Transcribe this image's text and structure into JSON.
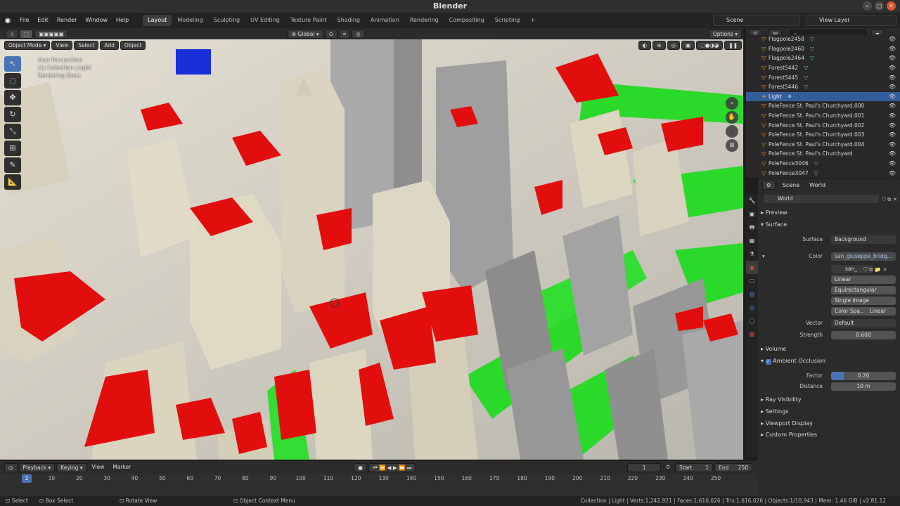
{
  "app": {
    "title": "Blender"
  },
  "menu": [
    "File",
    "Edit",
    "Render",
    "Window",
    "Help"
  ],
  "workspaces": [
    "Layout",
    "Modeling",
    "Sculpting",
    "UV Editing",
    "Texture Paint",
    "Shading",
    "Animation",
    "Rendering",
    "Compositing",
    "Scripting"
  ],
  "active_workspace": "Layout",
  "scene": {
    "scene_name": "Scene",
    "view_layer": "View Layer"
  },
  "viewport": {
    "mode": "Object Mode",
    "menus": [
      "View",
      "Select",
      "Add",
      "Object"
    ],
    "orientation": "Global",
    "options_label": "Options",
    "overlay_lines": [
      "User Perspective",
      "(1) Collection | Light",
      "Rendering Done"
    ]
  },
  "outliner": {
    "items": [
      {
        "name": "Flagpole2458",
        "mesh": true
      },
      {
        "name": "Flagpole2460",
        "mesh": true
      },
      {
        "name": "Flagpole2464",
        "mesh": true
      },
      {
        "name": "Forest5442",
        "mesh": true
      },
      {
        "name": "Forest5445",
        "mesh": true
      },
      {
        "name": "Forest5446",
        "mesh": true
      },
      {
        "name": "Light",
        "mesh": false,
        "selected": true
      },
      {
        "name": "PoleFence St. Paul's Churchyard.000",
        "mesh": false
      },
      {
        "name": "PoleFence St. Paul's Churchyard.001",
        "mesh": false
      },
      {
        "name": "PoleFence St. Paul's Churchyard.002",
        "mesh": false
      },
      {
        "name": "PoleFence St. Paul's Churchyard.003",
        "mesh": false
      },
      {
        "name": "PoleFence St. Paul's Churchyard.004",
        "mesh": false
      },
      {
        "name": "PoleFence St. Paul's Churchyard",
        "mesh": false
      },
      {
        "name": "PoleFence3046",
        "mesh": true
      },
      {
        "name": "PoleFence3047",
        "mesh": true
      }
    ]
  },
  "properties": {
    "breadcrumb": [
      "Scene",
      "World"
    ],
    "world_name": "World",
    "sections": {
      "preview": "Preview",
      "surface": "Surface",
      "volume": "Volume",
      "ao": "Ambient Occlusion",
      "ray_visibility": "Ray Visibility",
      "settings": "Settings",
      "viewport_display": "Viewport Display",
      "custom_properties": "Custom Properties"
    },
    "surface_label": "Surface",
    "surface_value": "Background",
    "color_label": "Color",
    "color_value": "san_giuseppe_bridg...",
    "image_name": "san_",
    "interp": "Linear",
    "projection": "Equirectangular",
    "source": "Single Image",
    "colorspace_label": "Color Spa..",
    "colorspace_value": "Linear",
    "vector_label": "Vector",
    "vector_value": "Default",
    "strength_label": "Strength",
    "strength_value": "0.600",
    "factor_label": "Factor",
    "factor_value": "0.20",
    "factor_fraction": 0.2,
    "distance_label": "Distance",
    "distance_value": "10 m"
  },
  "timeline": {
    "menus": [
      "Playback",
      "Keying",
      "View",
      "Marker"
    ],
    "current_frame": "1",
    "start_label": "Start",
    "start": "1",
    "end_label": "End",
    "end": "250",
    "ticks": [
      "1",
      "10",
      "20",
      "30",
      "40",
      "50",
      "60",
      "70",
      "80",
      "90",
      "100",
      "110",
      "120",
      "130",
      "140",
      "150",
      "160",
      "170",
      "180",
      "190",
      "200",
      "210",
      "220",
      "230",
      "240",
      "250"
    ]
  },
  "status": {
    "select": "Select",
    "box_select": "Box Select",
    "rotate_view": "Rotate View",
    "context_menu": "Object Context Menu",
    "stats": "Collection | Light | Verts:1,242,921 | Faces:1,616,026 | Tris:1,616,026 | Objects:1/10,943 | Mem: 1.46 GiB | v2.81.12"
  },
  "colors": {
    "accent": "#4a73b5",
    "roof_red": "#e01010",
    "grass_green": "#22dd22",
    "building": "#d8d2c2"
  }
}
